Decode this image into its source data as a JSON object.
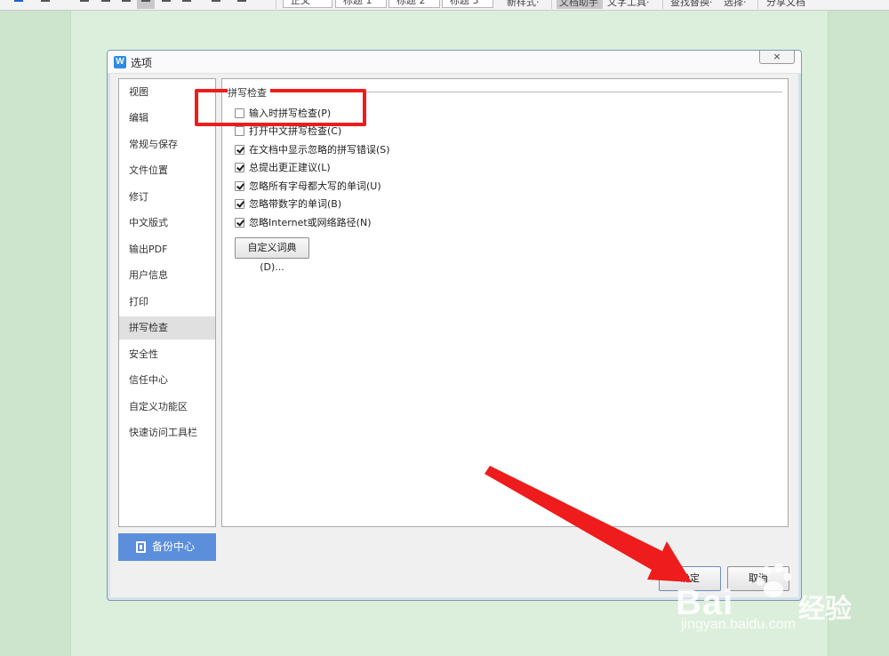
{
  "ribbon": {
    "styles": [
      "正文",
      "标题 1",
      "标题 2",
      "标题 3"
    ],
    "new_style": "新样式·",
    "doc_assist": "文档助手",
    "text_tools": "文字工具·",
    "find_replace": "查找替换·",
    "select": "选择·",
    "share_doc": "分享文档"
  },
  "dialog": {
    "title": "选项",
    "close_label": "×",
    "app_icon": "W"
  },
  "sidebar": {
    "items": [
      {
        "label": "视图"
      },
      {
        "label": "编辑"
      },
      {
        "label": "常规与保存"
      },
      {
        "label": "文件位置"
      },
      {
        "label": "修订"
      },
      {
        "label": "中文版式"
      },
      {
        "label": "输出PDF"
      },
      {
        "label": "用户信息"
      },
      {
        "label": "打印"
      },
      {
        "label": "拼写检查"
      },
      {
        "label": "安全性"
      },
      {
        "label": "信任中心"
      },
      {
        "label": "自定义功能区"
      },
      {
        "label": "快速访问工具栏"
      }
    ],
    "active_index": 9
  },
  "backup": {
    "label": "备份中心",
    "icon": "backup-icon"
  },
  "content": {
    "section_title": "拼写检查",
    "options": [
      {
        "label": "输入时拼写检查(P)",
        "checked": false
      },
      {
        "label": "打开中文拼写检查(C)",
        "checked": false
      },
      {
        "label": "在文档中显示忽略的拼写错误(S)",
        "checked": true
      },
      {
        "label": "总提出更正建议(L)",
        "checked": true
      },
      {
        "label": "忽略所有字母都大写的单词(U)",
        "checked": true
      },
      {
        "label": "忽略带数字的单词(B)",
        "checked": true
      },
      {
        "label": "忽略Internet或网络路径(N)",
        "checked": true
      }
    ],
    "dictionary_button": "自定义词典(D)..."
  },
  "buttons": {
    "ok": "确定",
    "cancel": "取消"
  },
  "annotation_color": "#ee1c1c",
  "watermark": {
    "logo": "Bai",
    "cn": "经验",
    "url": "jingyan.baidu.com"
  }
}
